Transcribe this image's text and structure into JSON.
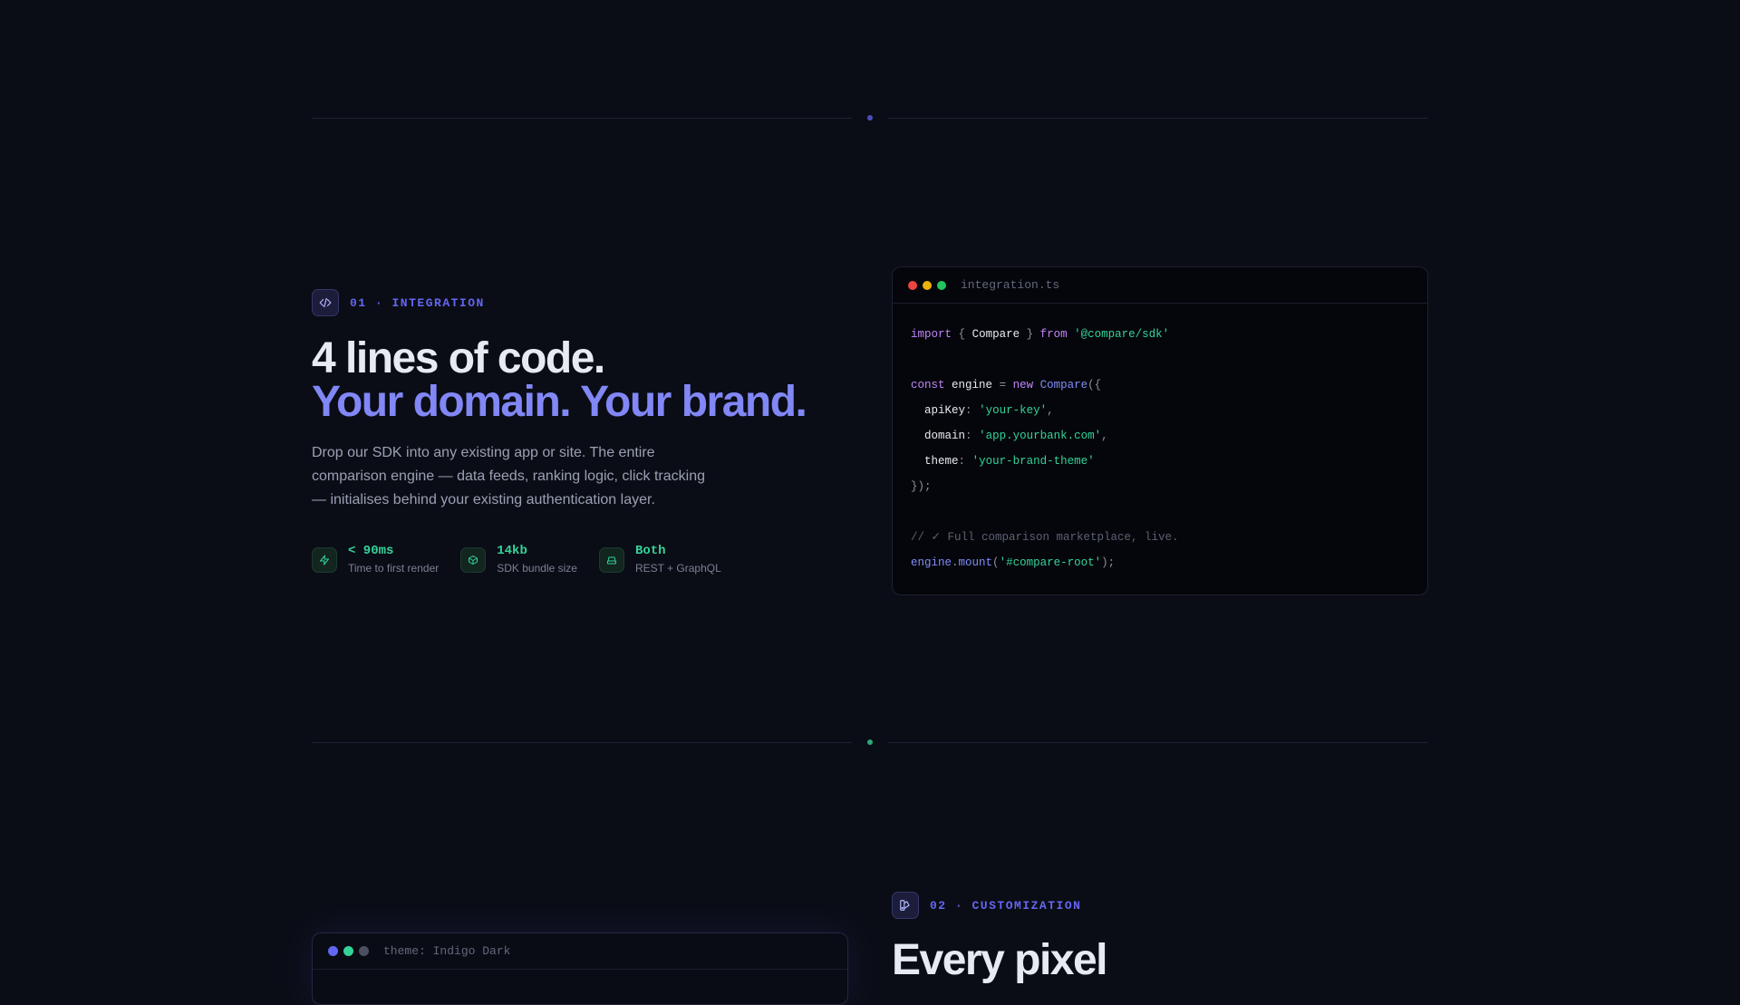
{
  "colors": {
    "background": "#0b0d16",
    "accent_indigo": "#818cf8",
    "accent_green": "#34d399"
  },
  "section1": {
    "icon": "code-icon",
    "eyebrow": "01 · INTEGRATION",
    "headline_line1": "4 lines of code.",
    "headline_line2": "Your domain. Your brand.",
    "description": "Drop our SDK into any existing app or site. The entire comparison engine — data feeds, ranking logic, click tracking — initialises behind your existing authentication layer.",
    "stats": [
      {
        "icon": "bolt-icon",
        "value": "< 90ms",
        "caption": "Time to first render"
      },
      {
        "icon": "box-icon",
        "value": "14kb",
        "caption": "SDK bundle size"
      },
      {
        "icon": "server-icon",
        "value": "Both",
        "caption": "REST + GraphQL"
      }
    ],
    "code_window": {
      "filename": "integration.ts",
      "lines": [
        "import { Compare } from '@compare/sdk'",
        "",
        "const engine = new Compare({",
        "  apiKey: 'your-key',",
        "  domain: 'app.yourbank.com',",
        "  theme: 'your-brand-theme'",
        "});",
        "",
        "// ✓ Full comparison marketplace, live.",
        "engine.mount('#compare-root');"
      ]
    }
  },
  "section2": {
    "icon": "palette-icon",
    "eyebrow": "02 · CUSTOMIZATION",
    "headline": "Every pixel",
    "theme_window": {
      "title": "theme: Indigo Dark"
    }
  }
}
